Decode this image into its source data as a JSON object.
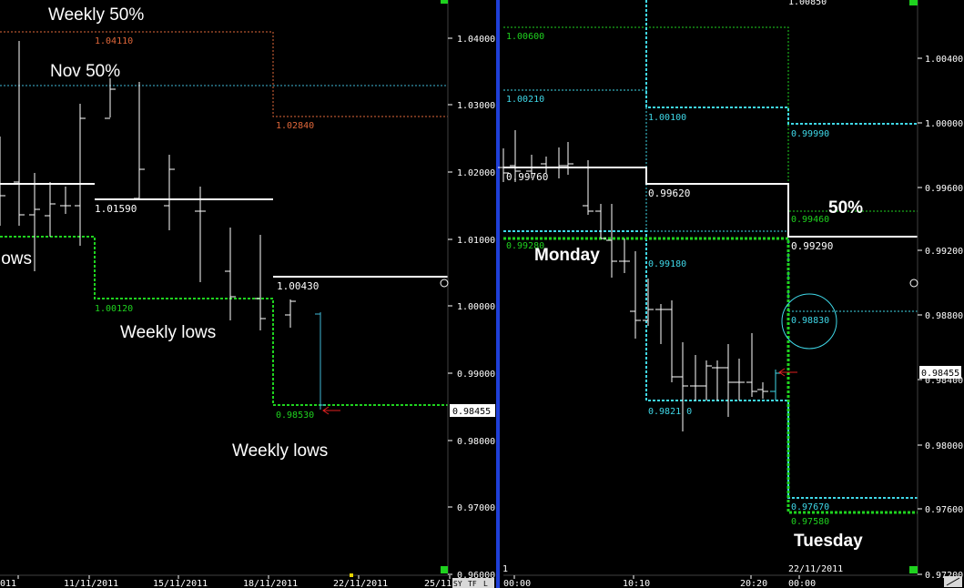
{
  "left_chart": {
    "annotations": {
      "weekly_50": "Weekly 50%",
      "nov_50": "Nov 50%",
      "lows_partial": "lows",
      "weekly_lows_1": "Weekly lows",
      "weekly_lows_2": "Weekly lows"
    },
    "y_ticks": [
      "1.04000",
      "1.03000",
      "1.02000",
      "1.01000",
      "1.00000",
      "0.99000",
      "0.98000",
      "0.97000",
      "0.96000"
    ],
    "x_ticks": [
      "011",
      "11/11/2011",
      "15/11/2011",
      "18/11/2011",
      "22/11/2011",
      "25/11"
    ],
    "price_tag": "0.98455",
    "level_labels": {
      "l104110": "1.04110",
      "l102840": "1.02840",
      "l101590": "1.01590",
      "l100430": "1.00430",
      "l100120": "1.00120",
      "l098530": "0.98530"
    },
    "colors": {
      "weekly_50": "#e0673a",
      "nov_50": "#3fb7d6",
      "weekly_low": "#1fd21f",
      "pivot": "#ffffff",
      "bars": "#ffffff",
      "last_bar": "#3fb7d6"
    }
  },
  "right_chart": {
    "annotations": {
      "monday": "Monday",
      "tuesday": "Tuesday",
      "fifty": "50%"
    },
    "y_ticks": [
      "1.00400",
      "1.00000",
      "0.99600",
      "0.99200",
      "0.98800",
      "0.98400",
      "0.98000",
      "0.97600",
      "0.97200"
    ],
    "top_cut_label": "1.00850",
    "x_ticks": [
      "00:00",
      "10:10",
      "20:20",
      "00:00"
    ],
    "x_date": "22/11/2011",
    "bottom_left": "1",
    "price_tag": "0.98455",
    "level_labels": {
      "l100600": "1.00600",
      "l100210": "1.00210",
      "l100100": "1.00100",
      "l099990": "0.99990",
      "l099760": "0.99760",
      "l099620": "0.99620",
      "l099460": "0.99460",
      "l099290": "0.99290",
      "l099280": "0.99280",
      "l099180": "0.99180",
      "l098830": "0.98830",
      "l098210": "0.9821 0",
      "l097670": "0.97670",
      "l097580": "0.97580"
    },
    "colors": {
      "divider": "#1f3fd8",
      "cyan": "#3fd8e8",
      "green": "#1fd21f",
      "white": "#ffffff",
      "circle": "#3fd8e8",
      "arrow": "#e02020"
    }
  },
  "status_icons": [
    "SY",
    "TF",
    "L"
  ]
}
